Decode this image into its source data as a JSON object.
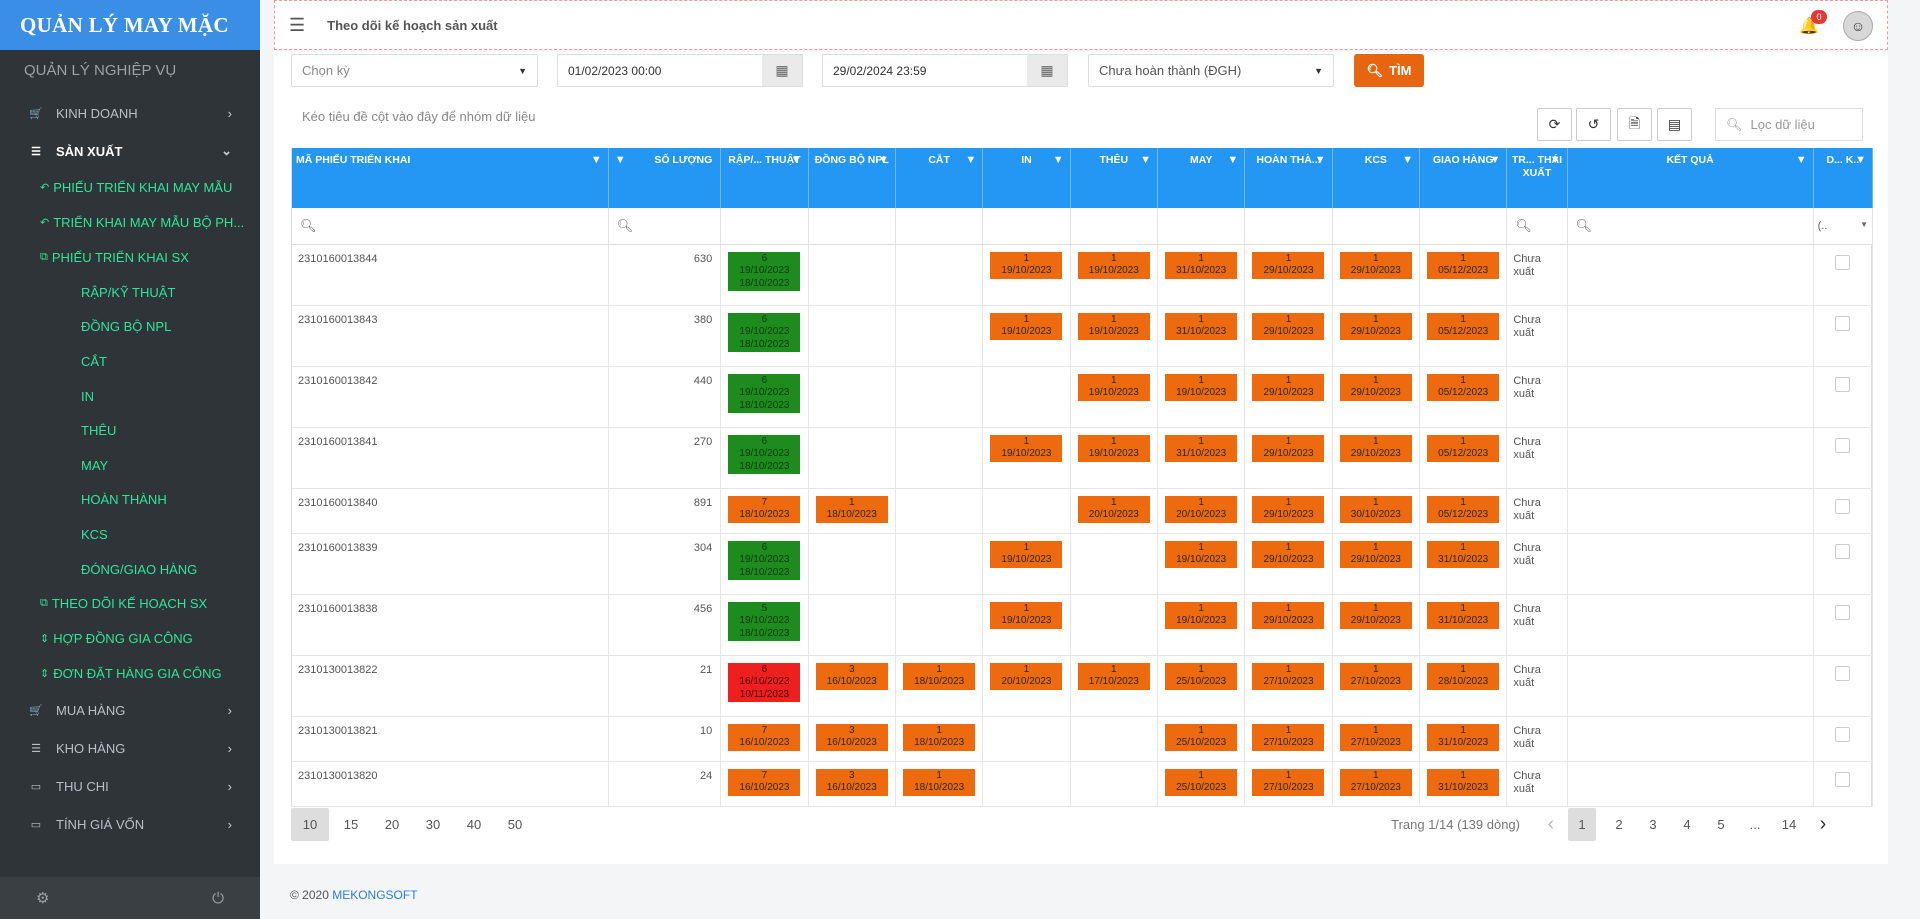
{
  "sidebar": {
    "brand": "QUẢN LÝ MAY MẶC",
    "section": "QUẢN LÝ NGHIỆP VỤ",
    "items": [
      {
        "label": "KINH DOANH",
        "icon": "cart-icon"
      },
      {
        "label": "SẢN XUẤT",
        "icon": "list-icon"
      },
      {
        "label": "MUA HÀNG",
        "icon": "cart-icon"
      },
      {
        "label": "KHO HÀNG",
        "icon": "list-icon"
      },
      {
        "label": "THU CHI",
        "icon": "card-icon"
      },
      {
        "label": "TÍNH GIÁ VỐN",
        "icon": "card-icon"
      }
    ],
    "sub": [
      {
        "label": "PHIẾU TRIỂN KHAI MAY MẪU"
      },
      {
        "label": "TRIỂN KHAI MAY MẪU BỘ PH..."
      },
      {
        "label": "PHIẾU TRIỂN KHAI SX"
      },
      {
        "label": "THEO DÕI KẾ HOẠCH SX"
      },
      {
        "label": "HỢP ĐỒNG GIA CÔNG"
      },
      {
        "label": "ĐƠN ĐẶT HÀNG GIA CÔNG"
      }
    ],
    "subsub": [
      "RẬP/KỸ THUẬT",
      "ĐỒNG BỘ NPL",
      "CẮT",
      "IN",
      "THÊU",
      "MAY",
      "HOÀN THÀNH",
      "KCS",
      "ĐÓNG/GIAO HÀNG"
    ]
  },
  "topbar": {
    "title": "Theo dõi kế hoạch sản xuất",
    "badge": "0"
  },
  "filters": {
    "period_placeholder": "Chọn kỳ",
    "from": "01/02/2023 00:00",
    "to": "29/02/2024 23:59",
    "status": "Chưa hoàn thành (ĐGH)",
    "search_label": "TÌM"
  },
  "groupbar": "Kéo tiêu đề cột vào đây để nhóm dữ liệu",
  "filter_placeholder": "Lọc dữ liệu",
  "columns": [
    "MÃ PHIẾU TRIỂN KHAI",
    "SỐ LƯỢNG",
    "RẬP/... THUẬT",
    "ĐỒNG BỘ NPL",
    "CẮT",
    "IN",
    "THÊU",
    "MAY",
    "HOÀN THÀ...",
    "KCS",
    "GIAO HÀNG",
    "TR... THÁI XUẤT",
    "KẾT QUẢ",
    "D... K.."
  ],
  "status_filter": "(..",
  "rows": [
    {
      "id": "2310160013844",
      "qty": "630",
      "status": "Chưa xuất",
      "cells": [
        [
          "g",
          "6",
          "19/10/2023",
          "18/10/2023"
        ],
        null,
        null,
        [
          "o",
          "1",
          "19/10/2023"
        ],
        [
          "o",
          "1",
          "19/10/2023"
        ],
        [
          "o",
          "1",
          "31/10/2023"
        ],
        [
          "o",
          "1",
          "29/10/2023"
        ],
        [
          "o",
          "1",
          "29/10/2023"
        ],
        [
          "o",
          "1",
          "05/12/2023"
        ]
      ]
    },
    {
      "id": "2310160013843",
      "qty": "380",
      "status": "Chưa xuất",
      "cells": [
        [
          "g",
          "6",
          "19/10/2023",
          "18/10/2023"
        ],
        null,
        null,
        [
          "o",
          "1",
          "19/10/2023"
        ],
        [
          "o",
          "1",
          "19/10/2023"
        ],
        [
          "o",
          "1",
          "31/10/2023"
        ],
        [
          "o",
          "1",
          "29/10/2023"
        ],
        [
          "o",
          "1",
          "29/10/2023"
        ],
        [
          "o",
          "1",
          "05/12/2023"
        ]
      ]
    },
    {
      "id": "2310160013842",
      "qty": "440",
      "status": "Chưa xuất",
      "cells": [
        [
          "g",
          "6",
          "19/10/2023",
          "18/10/2023"
        ],
        null,
        null,
        null,
        [
          "o",
          "1",
          "19/10/2023"
        ],
        [
          "o",
          "1",
          "19/10/2023"
        ],
        [
          "o",
          "1",
          "29/10/2023"
        ],
        [
          "o",
          "1",
          "29/10/2023"
        ],
        [
          "o",
          "1",
          "05/12/2023"
        ]
      ]
    },
    {
      "id": "2310160013841",
      "qty": "270",
      "status": "Chưa xuất",
      "cells": [
        [
          "g",
          "6",
          "19/10/2023",
          "18/10/2023"
        ],
        null,
        null,
        [
          "o",
          "1",
          "19/10/2023"
        ],
        [
          "o",
          "1",
          "19/10/2023"
        ],
        [
          "o",
          "1",
          "31/10/2023"
        ],
        [
          "o",
          "1",
          "29/10/2023"
        ],
        [
          "o",
          "1",
          "29/10/2023"
        ],
        [
          "o",
          "1",
          "05/12/2023"
        ]
      ]
    },
    {
      "id": "2310160013840",
      "qty": "891",
      "status": "Chưa xuất",
      "cells": [
        [
          "o",
          "7",
          "18/10/2023"
        ],
        [
          "o",
          "1",
          "18/10/2023"
        ],
        null,
        null,
        [
          "o",
          "1",
          "20/10/2023"
        ],
        [
          "o",
          "1",
          "20/10/2023"
        ],
        [
          "o",
          "1",
          "29/10/2023"
        ],
        [
          "o",
          "1",
          "30/10/2023"
        ],
        [
          "o",
          "1",
          "05/12/2023"
        ]
      ]
    },
    {
      "id": "2310160013839",
      "qty": "304",
      "status": "Chưa xuất",
      "cells": [
        [
          "g",
          "6",
          "19/10/2023",
          "18/10/2023"
        ],
        null,
        null,
        [
          "o",
          "1",
          "19/10/2023"
        ],
        null,
        [
          "o",
          "1",
          "19/10/2023"
        ],
        [
          "o",
          "1",
          "29/10/2023"
        ],
        [
          "o",
          "1",
          "29/10/2023"
        ],
        [
          "o",
          "1",
          "31/10/2023"
        ]
      ]
    },
    {
      "id": "2310160013838",
      "qty": "456",
      "status": "Chưa xuất",
      "cells": [
        [
          "g",
          "5",
          "19/10/2023",
          "18/10/2023"
        ],
        null,
        null,
        [
          "o",
          "1",
          "19/10/2023"
        ],
        null,
        [
          "o",
          "1",
          "19/10/2023"
        ],
        [
          "o",
          "1",
          "29/10/2023"
        ],
        [
          "o",
          "1",
          "29/10/2023"
        ],
        [
          "o",
          "1",
          "31/10/2023"
        ]
      ]
    },
    {
      "id": "2310130013822",
      "qty": "21",
      "status": "Chưa xuất",
      "cells": [
        [
          "r",
          "6",
          "16/10/2023",
          "10/11/2023"
        ],
        [
          "o",
          "3",
          "16/10/2023"
        ],
        [
          "o",
          "1",
          "18/10/2023"
        ],
        [
          "o",
          "1",
          "20/10/2023"
        ],
        [
          "o",
          "1",
          "17/10/2023"
        ],
        [
          "o",
          "1",
          "25/10/2023"
        ],
        [
          "o",
          "1",
          "27/10/2023"
        ],
        [
          "o",
          "1",
          "27/10/2023"
        ],
        [
          "o",
          "1",
          "28/10/2023"
        ]
      ]
    },
    {
      "id": "2310130013821",
      "qty": "10",
      "status": "Chưa xuất",
      "cells": [
        [
          "o",
          "7",
          "16/10/2023"
        ],
        [
          "o",
          "3",
          "16/10/2023"
        ],
        [
          "o",
          "1",
          "18/10/2023"
        ],
        null,
        null,
        [
          "o",
          "1",
          "25/10/2023"
        ],
        [
          "o",
          "1",
          "27/10/2023"
        ],
        [
          "o",
          "1",
          "27/10/2023"
        ],
        [
          "o",
          "1",
          "31/10/2023"
        ]
      ]
    },
    {
      "id": "2310130013820",
      "qty": "24",
      "status": "Chưa xuất",
      "cells": [
        [
          "o",
          "7",
          "16/10/2023"
        ],
        [
          "o",
          "3",
          "16/10/2023"
        ],
        [
          "o",
          "1",
          "18/10/2023"
        ],
        null,
        null,
        [
          "o",
          "1",
          "25/10/2023"
        ],
        [
          "o",
          "1",
          "27/10/2023"
        ],
        [
          "o",
          "1",
          "27/10/2023"
        ],
        [
          "o",
          "1",
          "31/10/2023"
        ]
      ]
    }
  ],
  "pager": {
    "sizes": [
      "10",
      "15",
      "20",
      "30",
      "40",
      "50"
    ],
    "info": "Trang 1/14 (139 dòng)",
    "pages": [
      "1",
      "2",
      "3",
      "4",
      "5",
      "...",
      "14"
    ]
  },
  "footer": {
    "copy": "© 2020",
    "link": "MEKONGSOFT"
  },
  "colors": {
    "brand": "#3a8ee6",
    "header": "#2496f3",
    "orange": "#ee6a0e",
    "green": "#1e8b1e",
    "red": "#ee1f1f",
    "search": "#e8650f"
  }
}
